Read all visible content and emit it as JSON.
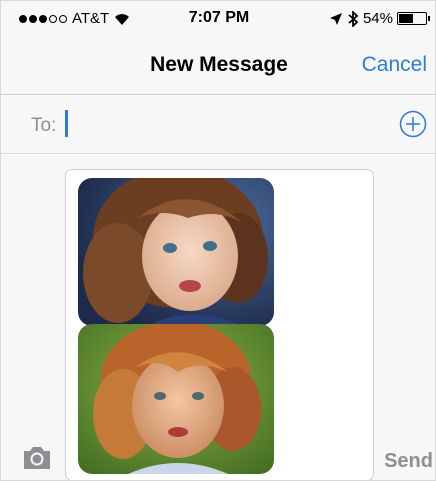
{
  "status_bar": {
    "carrier": "AT&T",
    "time": "7:07 PM",
    "battery": "54%",
    "battery_level": 0.54,
    "signal_bars_filled": 3,
    "signal_bars_total": 5
  },
  "navbar": {
    "title": "New Message",
    "cancel_label": "Cancel"
  },
  "recipient": {
    "label": "To:",
    "value": ""
  },
  "compose": {
    "attachments": [
      "photo-girl-blue-shirt",
      "photo-girl-outdoors"
    ],
    "send_label": "Send"
  },
  "colors": {
    "accent": "#2f7bd8",
    "bar_background": "#f7f7f8",
    "muted_text": "#8e8e93"
  },
  "icons": {
    "location": "location-arrow-icon",
    "bluetooth": "bluetooth-icon",
    "wifi": "wifi-icon",
    "add_contact": "add-contact-icon",
    "camera": "camera-icon"
  }
}
